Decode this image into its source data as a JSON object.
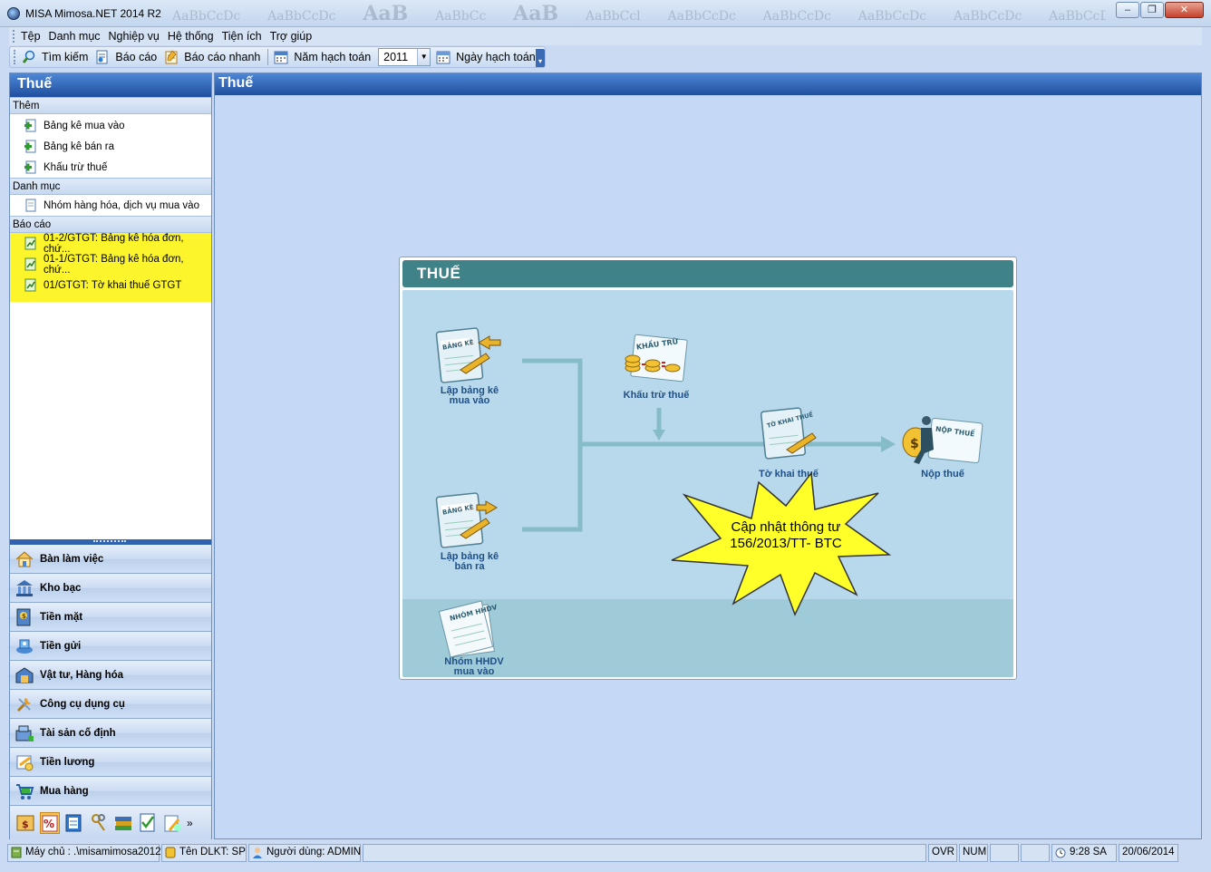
{
  "window": {
    "title": "MISA Mimosa.NET 2014 R2",
    "ghost_styles": [
      "AaBbCcDc",
      "AaBbCcDc",
      "AaB",
      "AaBbCc",
      "AaB",
      "AaBbCcl",
      "AaBbCcDc",
      "AaBbCcDc",
      "AaBbCcDc",
      "AaBbCcDc",
      "AaBbCcDc"
    ],
    "minimize": "–",
    "restore": "❐",
    "close": "✕"
  },
  "menu": [
    "Tệp",
    "Danh mục",
    "Nghiệp vụ",
    "Hệ thống",
    "Tiện ích",
    "Trợ giúp"
  ],
  "toolbar": {
    "search_label": "Tìm kiếm",
    "report_label": "Báo cáo",
    "quick_report_label": "Báo cáo nhanh",
    "fiscal_year_label": "Năm hạch toán",
    "fiscal_year_value": "2011",
    "posting_date_label": "Ngày hạch toán"
  },
  "left_panel": {
    "title": "Thuế",
    "groups": [
      {
        "header": "Thêm",
        "items": [
          "Bảng kê mua vào",
          "Bảng kê bán ra",
          "Khấu trừ thuế"
        ]
      },
      {
        "header": "Danh mục",
        "items": [
          "Nhóm hàng hóa, dịch vụ mua vào"
        ]
      },
      {
        "header": "Báo cáo",
        "items": [
          "01-2/GTGT: Bảng kê hóa đơn, chứ...",
          "01-1/GTGT: Bảng kê hóa đơn, chứ...",
          "01/GTGT: Tờ khai thuế GTGT"
        ]
      }
    ],
    "nav": [
      "Bàn làm việc",
      "Kho bạc",
      "Tiền mặt",
      "Tiền gửi",
      "Vật tư, Hàng hóa",
      "Công cụ dụng cụ",
      "Tài sản cố định",
      "Tiền lương",
      "Mua hàng"
    ],
    "more_glyph": "»"
  },
  "main": {
    "title": "Thuế",
    "diagram": {
      "title": "THUẾ",
      "nodes": {
        "purchase_list": "Lập bảng kê\nmua vào",
        "sales_list": "Lập bảng kê\nbán ra",
        "deduction": "Khấu trừ thuế",
        "declaration": "Tờ khai thuế",
        "payment": "Nộp thuế",
        "goods_group": "Nhóm HHDV\nmua vào"
      },
      "icon_text": {
        "bang_ke": "BẢNG KÊ",
        "khau_tru": "KHẤU TRỪ",
        "to_khai": "TỜ KHAI THUẾ",
        "nop_thue": "NỘP THUẾ",
        "nhom_hhdv": "NHÓM HHDV"
      },
      "callout": "Cập nhật thông tư\n156/2013/TT- BTC"
    }
  },
  "status": {
    "server": "Máy chủ : .\\misamimosa2012",
    "db": "Tên DLKT: SP",
    "user": "Người dùng: ADMIN",
    "ovr": "OVR",
    "num": "NUM",
    "time": "9:28 SA",
    "date": "20/06/2014"
  },
  "colors": {
    "header_blue": "#1f4f9e",
    "report_highlight": "#fdf52c",
    "diagram_header": "#3f8288",
    "diagram_body": "#b8d9eb"
  }
}
